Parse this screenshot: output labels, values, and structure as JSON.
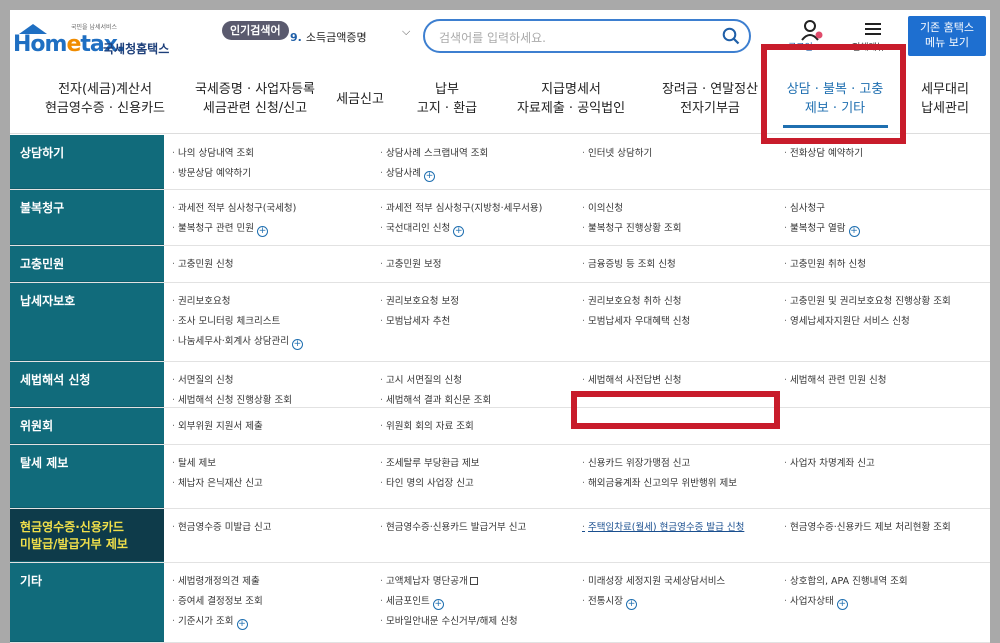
{
  "header": {
    "logo_sub": "국민을 납세서비스",
    "logo_home": "Hom",
    "logo_e": "e",
    "logo_tax": "tax.",
    "logo_kr": "국세청홈택스",
    "popular_badge": "인기검색어",
    "popular_rank": "9.",
    "popular_term": "소득금액증명",
    "search_placeholder": "검색어를 입력하세요.",
    "user_label": "로그인",
    "menu_label": "전체메뉴",
    "old_hometax_button": "기존 홈택스\n메뉴 보기"
  },
  "nav": [
    "전자(세금)계산서\n현금영수증 · 신용카드",
    "국세증명 · 사업자등록\n세금관련 신청/신고",
    "세금신고",
    "납부\n고지 · 환급",
    "지급명세서\n자료제출 · 공익법인",
    "장려금 · 연말정산\n전자기부금",
    "상담 · 불복 · 고충\n제보 · 기타",
    "세무대리\n납세관리"
  ],
  "rows": [
    {
      "cat": "상담하기",
      "links": [
        [
          "나의 상담내역 조회",
          "방문상담 예약하기"
        ],
        [
          "상담사례 스크랩내역 조회",
          "상담사례"
        ],
        [
          "인터넷 상담하기"
        ],
        [
          "전화상담 예약하기"
        ]
      ]
    },
    {
      "cat": "불복청구",
      "links": [
        [
          "과세전 적부 심사청구(국세청)",
          "불복청구 관련 민원"
        ],
        [
          "과세전 적부 심사청구(지방청·세무서용)",
          "국선대리인 신청"
        ],
        [
          "이의신청",
          "불복청구 진행상황 조회"
        ],
        [
          "심사청구",
          "불복청구 열람"
        ]
      ]
    },
    {
      "cat": "고충민원",
      "links": [
        [
          "고충민원 신청"
        ],
        [
          "고충민원 보정"
        ],
        [
          "금융증빙 등 조회 신청"
        ],
        [
          "고충민원 취하 신청"
        ]
      ]
    },
    {
      "cat": "납세자보호",
      "links": [
        [
          "권리보호요청",
          "조사 모니터링 체크리스트",
          "나눔세무사·회계사 상담관리"
        ],
        [
          "권리보호요청 보정",
          "모범납세자 추천"
        ],
        [
          "권리보호요청 취하 신청",
          "모범납세자 우대혜택 신청"
        ],
        [
          "고충민원 및 권리보호요청 진행상황 조회",
          "영세납세자지원단 서비스 신청"
        ]
      ]
    },
    {
      "cat": "세법해석 신청",
      "links": [
        [
          "서면질의 신청",
          "세법해석 신청 진행상황 조회"
        ],
        [
          "고시 서면질의 신청",
          "세법해석 결과 회신문 조회"
        ],
        [
          "세법해석 사전답변 신청"
        ],
        [
          "세법해석 관련 민원 신청"
        ]
      ]
    },
    {
      "cat": "위원회",
      "links": [
        [
          "외부위원 지원서 제출"
        ],
        [
          "위원회 회의 자료 조회"
        ],
        [],
        []
      ]
    },
    {
      "cat": "탈세 제보",
      "links": [
        [
          "탈세 제보",
          "체납자 은닉재산 신고"
        ],
        [
          "조세탈루 부당환급 제보",
          "타인 명의 사업장 신고"
        ],
        [
          "신용카드 위장가맹점 신고",
          "해외금융계좌 신고의무 위반행위 제보"
        ],
        [
          "사업자 차명계좌 신고"
        ]
      ]
    },
    {
      "cat": "현금영수증·신용카드\n미발급/발급거부 제보",
      "links": [
        [
          "현금영수증 미발급 신고"
        ],
        [
          "현금영수증·신용카드 발급거부 신고"
        ],
        [
          "주택임차료(월세) 현금영수증 발급 신청"
        ],
        [
          "현금영수증·신용카드 제보 처리현황 조회"
        ]
      ]
    },
    {
      "cat": "기타",
      "links": [
        [
          "세법령개정의견 제출",
          "증여세 결정정보 조회",
          "기준시가 조회"
        ],
        [
          "고액체납자 명단공개",
          "세금포인트",
          "모바일안내문 수신거부/해제 신청"
        ],
        [
          "미래성장 세정지원 국세상담서비스",
          "전통시장"
        ],
        [
          "상호합의, APA 진행내역 조회",
          "사업자상태"
        ]
      ]
    }
  ]
}
